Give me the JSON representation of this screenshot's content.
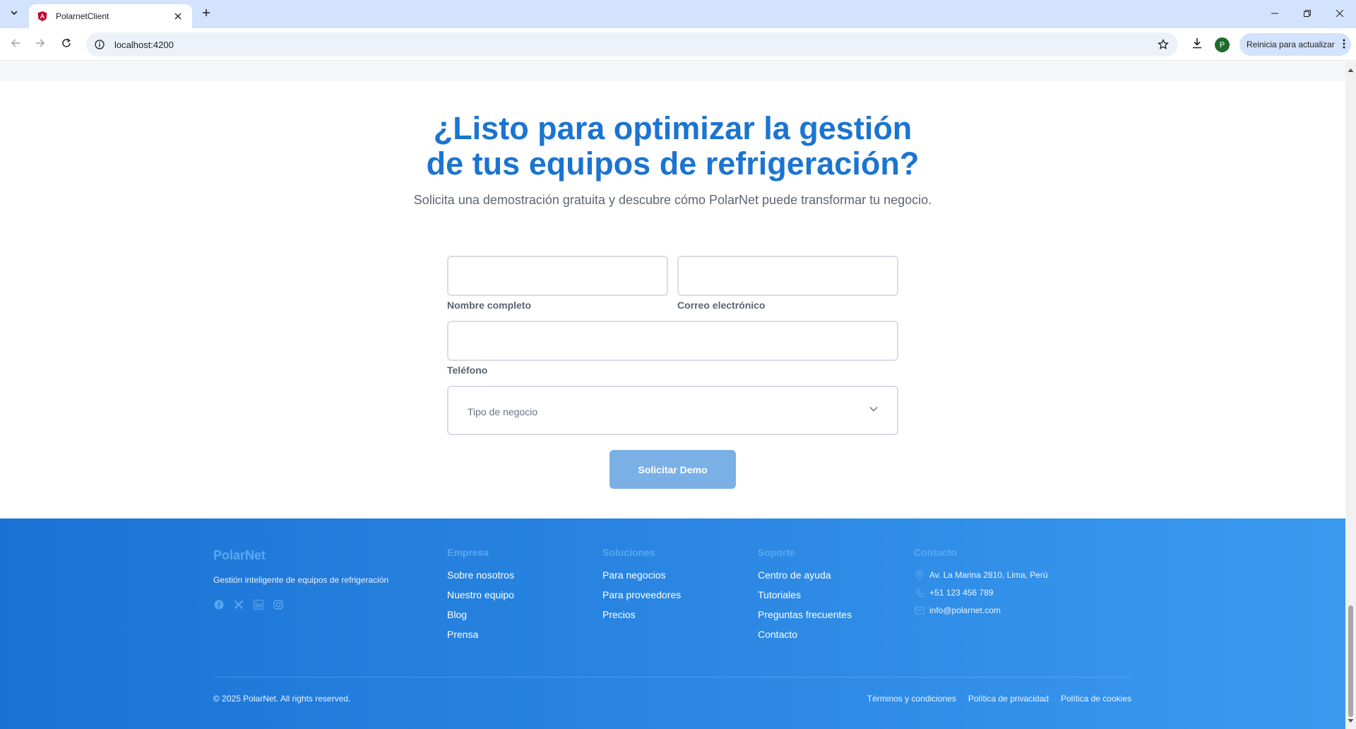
{
  "browser": {
    "tab_title": "PolarnetClient",
    "url": "localhost:4200",
    "update_label": "Reinicia para actualizar",
    "profile_initial": "P"
  },
  "cta": {
    "title_line1": "¿Listo para optimizar la gestión",
    "title_line2": "de tus equipos de refrigeración?",
    "subtitle": "Solicita una demostración gratuita y descubre cómo PolarNet puede transformar tu negocio.",
    "accent_color": "#1c74d0"
  },
  "form": {
    "name_label": "Nombre completo",
    "email_label": "Correo electrónico",
    "phone_label": "Teléfono",
    "business_type_placeholder": "Tipo de negocio",
    "submit_label": "Solicitar Demo"
  },
  "footer": {
    "brand": "PolarNet",
    "tagline": "Gestión inteligente de equipos de refrigeración",
    "social_icons": [
      "facebook-icon",
      "x-icon",
      "linkedin-icon",
      "instagram-icon"
    ],
    "columns": [
      {
        "title": "Empresa",
        "links": [
          "Sobre nosotros",
          "Nuestro equipo",
          "Blog",
          "Prensa"
        ]
      },
      {
        "title": "Soluciones",
        "links": [
          "Para negocios",
          "Para proveedores",
          "Precios"
        ]
      },
      {
        "title": "Soporte",
        "links": [
          "Centro de ayuda",
          "Tutoriales",
          "Preguntas frecuentes",
          "Contacto"
        ]
      }
    ],
    "contact": {
      "title": "Contacto",
      "address": "Av. La Marina 2810, Lima, Perú",
      "phone": "+51 123 456 789",
      "email": "info@polarnet.com"
    },
    "copyright": "© 2025 PolarNet. All rights reserved.",
    "legal": [
      "Términos y condiciones",
      "Política de privacidad",
      "Política de cookies"
    ]
  }
}
